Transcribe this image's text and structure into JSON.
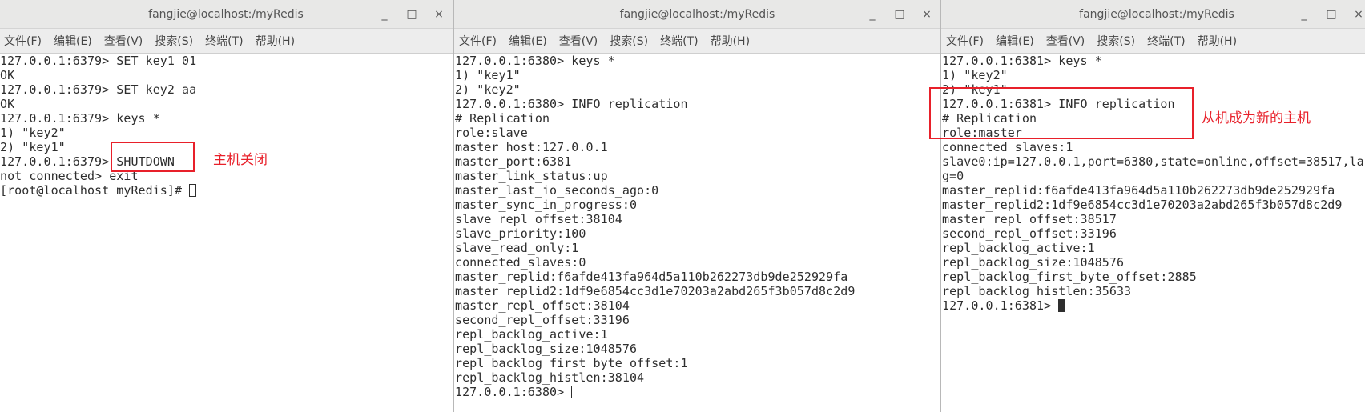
{
  "windows": [
    {
      "title": "fangjie@localhost:/myRedis",
      "menu": [
        "文件(F)",
        "编辑(E)",
        "查看(V)",
        "搜索(S)",
        "终端(T)",
        "帮助(H)"
      ],
      "lines": [
        "127.0.0.1:6379> SET key1 01",
        "OK",
        "127.0.0.1:6379> SET key2 aa",
        "OK",
        "127.0.0.1:6379> keys *",
        "1) \"key2\"",
        "2) \"key1\"",
        "127.0.0.1:6379> SHUTDOWN",
        "not connected> exit",
        "[root@localhost myRedis]# "
      ],
      "annotation": "主机关闭"
    },
    {
      "title": "fangjie@localhost:/myRedis",
      "menu": [
        "文件(F)",
        "编辑(E)",
        "查看(V)",
        "搜索(S)",
        "终端(T)",
        "帮助(H)"
      ],
      "lines": [
        "127.0.0.1:6380> keys *",
        "1) \"key1\"",
        "2) \"key2\"",
        "127.0.0.1:6380> INFO replication",
        "# Replication",
        "role:slave",
        "master_host:127.0.0.1",
        "master_port:6381",
        "master_link_status:up",
        "master_last_io_seconds_ago:0",
        "master_sync_in_progress:0",
        "slave_repl_offset:38104",
        "slave_priority:100",
        "slave_read_only:1",
        "connected_slaves:0",
        "master_replid:f6afde413fa964d5a110b262273db9de252929fa",
        "master_replid2:1df9e6854cc3d1e70203a2abd265f3b057d8c2d9",
        "master_repl_offset:38104",
        "second_repl_offset:33196",
        "repl_backlog_active:1",
        "repl_backlog_size:1048576",
        "repl_backlog_first_byte_offset:1",
        "repl_backlog_histlen:38104",
        "127.0.0.1:6380> "
      ]
    },
    {
      "title": "fangjie@localhost:/myRedis",
      "menu": [
        "文件(F)",
        "编辑(E)",
        "查看(V)",
        "搜索(S)",
        "终端(T)",
        "帮助(H)"
      ],
      "lines": [
        "127.0.0.1:6381> keys *",
        "1) \"key2\"",
        "2) \"key1\"",
        "127.0.0.1:6381> INFO replication",
        "# Replication",
        "role:master",
        "connected_slaves:1",
        "slave0:ip=127.0.0.1,port=6380,state=online,offset=38517,la",
        "g=0",
        "master_replid:f6afde413fa964d5a110b262273db9de252929fa",
        "master_replid2:1df9e6854cc3d1e70203a2abd265f3b057d8c2d9",
        "master_repl_offset:38517",
        "second_repl_offset:33196",
        "repl_backlog_active:1",
        "repl_backlog_size:1048576",
        "repl_backlog_first_byte_offset:2885",
        "repl_backlog_histlen:35633",
        "127.0.0.1:6381> "
      ],
      "annotation": "从机成为新的主机"
    }
  ],
  "window_controls": {
    "minimize": "_",
    "maximize": "□",
    "close": "×"
  },
  "colors": {
    "annotation": "#e8202a"
  }
}
